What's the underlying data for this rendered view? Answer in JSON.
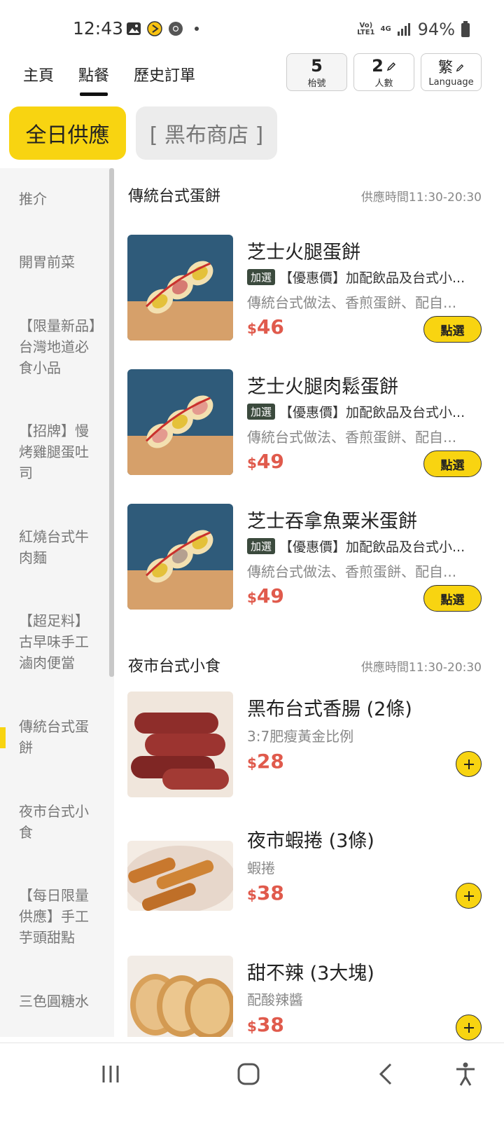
{
  "status_bar": {
    "time": "12:43",
    "network_top": "Vo)",
    "network_bottom": "LTE1",
    "net_type": "4G",
    "battery": "94%"
  },
  "nav": {
    "tabs": [
      {
        "label": "主頁"
      },
      {
        "label": "點餐"
      },
      {
        "label": "歷史訂單"
      }
    ],
    "table_value": "5",
    "table_label": "枱號",
    "people_value": "2",
    "people_label": "人數",
    "lang_value": "繁",
    "lang_label": "Language"
  },
  "categories": [
    {
      "label": "全日供應"
    },
    {
      "label": "[ 黑布商店 ]"
    }
  ],
  "sidebar": {
    "items": [
      {
        "label": "推介"
      },
      {
        "label": "開胃前菜"
      },
      {
        "label": "【限量新品】台灣地道必食小品"
      },
      {
        "label": "【招牌】慢烤雞腿蛋吐司"
      },
      {
        "label": "紅燒台式牛肉麵"
      },
      {
        "label": "【超足料】古早味手工滷肉便當"
      },
      {
        "label": "傳統台式蛋餅"
      },
      {
        "label": "夜市台式小食"
      },
      {
        "label": "【每日限量供應】手工芋頭甜點"
      },
      {
        "label": "三色圓糖水"
      }
    ]
  },
  "sections": [
    {
      "title": "傳統台式蛋餅",
      "serve_time": "供應時間11:30-20:30",
      "items": [
        {
          "name": "芝士火腿蛋餅",
          "tag": "加選",
          "promo": "【優惠價】加配飲品及台式小...",
          "desc": "傳統台式做法、香煎蛋餅、配自...",
          "currency": "$",
          "price": "46",
          "button": "點選"
        },
        {
          "name": "芝士火腿肉鬆蛋餅",
          "tag": "加選",
          "promo": "【優惠價】加配飲品及台式小...",
          "desc": "傳統台式做法、香煎蛋餅、配自...",
          "currency": "$",
          "price": "49",
          "button": "點選"
        },
        {
          "name": "芝士吞拿魚粟米蛋餅",
          "tag": "加選",
          "promo": "【優惠價】加配飲品及台式小...",
          "desc": "傳統台式做法、香煎蛋餅、配自...",
          "currency": "$",
          "price": "49",
          "button": "點選"
        }
      ]
    },
    {
      "title": "夜市台式小食",
      "serve_time": "供應時間11:30-20:30",
      "items": [
        {
          "name": "黑布台式香腸 (2條)",
          "desc": "3:7肥瘦黃金比例",
          "currency": "$",
          "price": "28"
        },
        {
          "name": "夜市蝦捲 (3條)",
          "desc": "蝦捲",
          "currency": "$",
          "price": "38"
        },
        {
          "name": "甜不辣 (3大塊)",
          "desc": "配酸辣醬",
          "currency": "$",
          "price": "38"
        }
      ]
    }
  ],
  "colors": {
    "accent": "#f8d411",
    "price": "#e05a4c",
    "tag_bg": "#3b4a3d"
  },
  "icons": [
    "gallery-icon",
    "play-icon",
    "chrome-icon",
    "signal-icon",
    "battery-icon",
    "pencil-icon",
    "plus-icon",
    "recent-apps-icon",
    "home-icon",
    "back-icon",
    "accessibility-icon"
  ]
}
